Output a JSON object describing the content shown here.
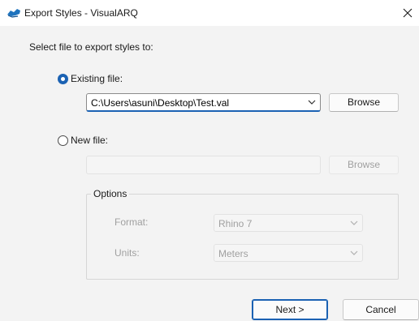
{
  "window": {
    "title": "Export Styles - VisualARQ"
  },
  "prompt": "Select file to export styles to:",
  "existing_file": {
    "label": "Existing file:",
    "selected": true,
    "path": "C:\\Users\\asuni\\Desktop\\Test.val",
    "browse_label": "Browse"
  },
  "new_file": {
    "label": "New file:",
    "selected": false,
    "path": "",
    "browse_label": "Browse"
  },
  "options": {
    "title": "Options",
    "format_label": "Format:",
    "format_value": "Rhino 7",
    "units_label": "Units:",
    "units_value": "Meters"
  },
  "footer": {
    "next_label": "Next >",
    "cancel_label": "Cancel"
  },
  "colors": {
    "accent": "#1b62b3",
    "disabled_text": "#a0a0a0"
  },
  "icons": {
    "app": "visualarq-logo-icon",
    "close": "close-icon",
    "dropdown": "chevron-down-icon"
  }
}
